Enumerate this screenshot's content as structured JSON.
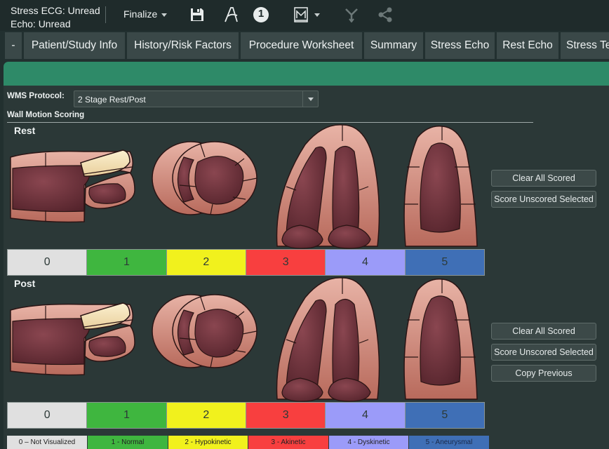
{
  "status": {
    "line1": "Stress ECG: Unread",
    "line2": "Echo: Unread"
  },
  "toolbar": {
    "finalize_label": "Finalize",
    "badge_number": "1",
    "icons": [
      "save-icon",
      "signature-icon",
      "numbered-badge-icon",
      "macro-icon",
      "merge-arrow-icon",
      "share-icon"
    ]
  },
  "tabs": [
    {
      "label": "-"
    },
    {
      "label": "Patient/Study Info"
    },
    {
      "label": "History/Risk Factors"
    },
    {
      "label": "Procedure Worksheet"
    },
    {
      "label": "Summary"
    },
    {
      "label": "Stress Echo"
    },
    {
      "label": "Rest Echo"
    },
    {
      "label": "Stress Te"
    }
  ],
  "protocol": {
    "label": "WMS Protocol:",
    "value": "2 Stage Rest/Post"
  },
  "wms_title": "Wall Motion Scoring",
  "rest": {
    "label": "Rest"
  },
  "post": {
    "label": "Post"
  },
  "score_scale": [
    {
      "value": "0",
      "color": "#e0e0e0"
    },
    {
      "value": "1",
      "color": "#3fb63f"
    },
    {
      "value": "2",
      "color": "#f1f11d"
    },
    {
      "value": "3",
      "color": "#f83f3f"
    },
    {
      "value": "4",
      "color": "#9b9bf9"
    },
    {
      "value": "5",
      "color": "#3f6fb6"
    }
  ],
  "buttons": {
    "clear_all": "Clear All Scored",
    "score_unscored": "Score Unscored Selected",
    "copy_previous": "Copy Previous"
  },
  "legend": [
    {
      "label": "0 – Not Visualized",
      "color": "#e0e0e0"
    },
    {
      "label": "1 - Normal",
      "color": "#3fb63f"
    },
    {
      "label": "2 - Hypokinetic",
      "color": "#f1f11d"
    },
    {
      "label": "3 - Akinetic",
      "color": "#f83f3f"
    },
    {
      "label": "4 - Dyskinetic",
      "color": "#9b9bf9"
    },
    {
      "label": "5 - Aneurysmal",
      "color": "#3f6fb6"
    }
  ],
  "colors": {
    "accent": "#2e8a68",
    "myocardium": "#d9968a",
    "cavity": "#6e3038",
    "highlight_segment": "#f5dfb0"
  }
}
